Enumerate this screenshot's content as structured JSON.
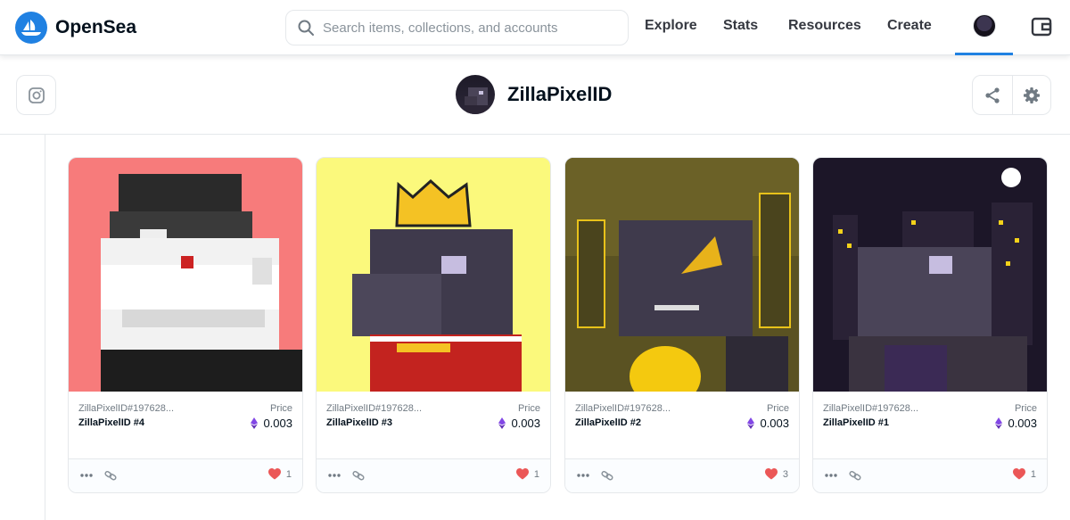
{
  "nav": {
    "brand": "OpenSea",
    "search_placeholder": "Search items, collections, and accounts",
    "links": [
      "Explore",
      "Stats",
      "Resources",
      "Create"
    ]
  },
  "profile": {
    "name": "ZillaPixelID"
  },
  "colors": {
    "accent": "#2081e2",
    "heart": "#eb5757",
    "eth": "#6f42c1"
  },
  "cards": [
    {
      "collection": "ZillaPixelID#197628...",
      "name": "ZillaPixelID #4",
      "price_label": "Price",
      "price": "0.003",
      "likes": "1",
      "bg": "#f77b7b"
    },
    {
      "collection": "ZillaPixelID#197628...",
      "name": "ZillaPixelID #3",
      "price_label": "Price",
      "price": "0.003",
      "likes": "1",
      "bg": "#fbf97c"
    },
    {
      "collection": "ZillaPixelID#197628...",
      "name": "ZillaPixelID #2",
      "price_label": "Price",
      "price": "0.003",
      "likes": "3",
      "bg": "#5a5222"
    },
    {
      "collection": "ZillaPixelID#197628...",
      "name": "ZillaPixelID #1",
      "price_label": "Price",
      "price": "0.003",
      "likes": "1",
      "bg": "#1c1628"
    }
  ],
  "icons": {
    "brand": "opensea-logo-icon",
    "search": "search-icon",
    "wallet": "wallet-icon",
    "instagram": "instagram-icon",
    "share": "share-icon",
    "settings": "gear-icon",
    "eth": "ethereum-icon",
    "more": "more-dots-icon",
    "link": "link-icon",
    "heart": "heart-icon"
  }
}
